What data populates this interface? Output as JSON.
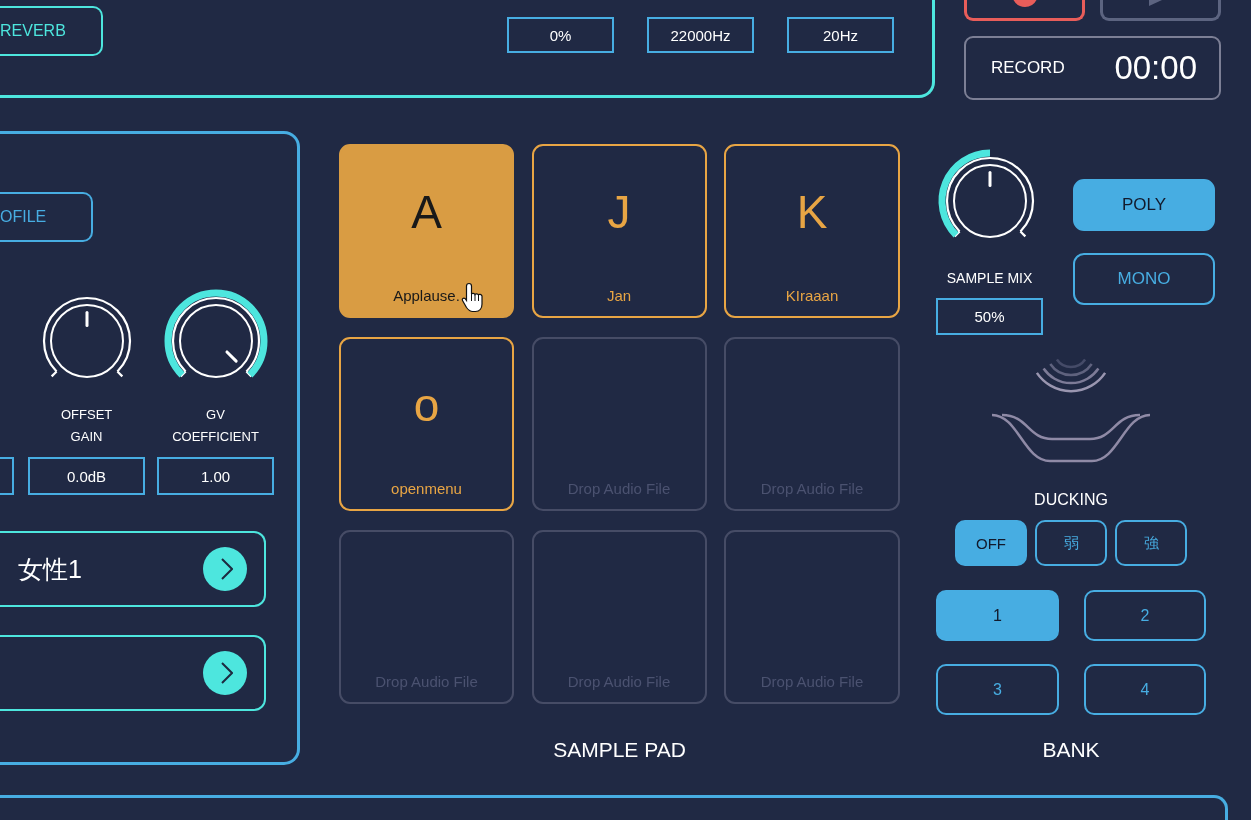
{
  "top_panel": {
    "reverb_button": "REVERB",
    "fields": [
      {
        "value": "0%"
      },
      {
        "value": "22000Hz"
      },
      {
        "value": "20Hz"
      }
    ]
  },
  "record_display": {
    "label": "RECORD",
    "time": "00:00"
  },
  "left_panel": {
    "profile_button": "OFILE",
    "knobs": [
      {
        "label": "OFFSET GAIN",
        "level": 0.5,
        "bipolar": true,
        "value": "0.0dB"
      },
      {
        "label": "GV COEFFICIENT",
        "level": 1,
        "bipolar": false,
        "value": "1.00"
      }
    ],
    "voice_selectors": [
      {
        "kind": "picker",
        "value": "女性1"
      },
      {
        "kind": "picker"
      }
    ]
  },
  "sample_pad": {
    "title": "SAMPLE PAD",
    "pads": [
      {
        "kind": "loaded",
        "key": "A",
        "name": "Applause.",
        "selected": true
      },
      {
        "kind": "loaded",
        "key": "J",
        "name": "Jan",
        "selected": false
      },
      {
        "kind": "loaded",
        "key": "K",
        "name": "KIraaan",
        "selected": false
      },
      {
        "kind": "loaded",
        "key": "o",
        "name": "openmenu",
        "selected": false
      },
      {
        "kind": "empty",
        "placeholder": "Drop Audio File",
        "selected": false
      },
      {
        "kind": "empty",
        "placeholder": "Drop Audio File",
        "selected": false
      },
      {
        "kind": "empty",
        "placeholder": "Drop Audio File",
        "selected": false
      },
      {
        "kind": "empty",
        "placeholder": "Drop Audio File",
        "selected": false
      },
      {
        "kind": "empty",
        "placeholder": "Drop Audio File",
        "selected": false
      }
    ]
  },
  "right_panel": {
    "sample_mix": {
      "label": "SAMPLE MIX",
      "level": 0.5,
      "bipolar": false,
      "value": "50%"
    },
    "modes": [
      {
        "label": "POLY",
        "selected": true
      },
      {
        "label": "MONO",
        "selected": false
      }
    ],
    "ducking": {
      "title": "DUCKING",
      "options": [
        {
          "label": "OFF",
          "selected": true
        },
        {
          "label": "弱",
          "selected": false
        },
        {
          "label": "強",
          "selected": false
        }
      ]
    },
    "bank": {
      "title": "BANK",
      "options": [
        {
          "label": "1",
          "selected": true
        },
        {
          "label": "2",
          "selected": false
        },
        {
          "label": "3",
          "selected": false
        },
        {
          "label": "4",
          "selected": false
        }
      ]
    }
  }
}
